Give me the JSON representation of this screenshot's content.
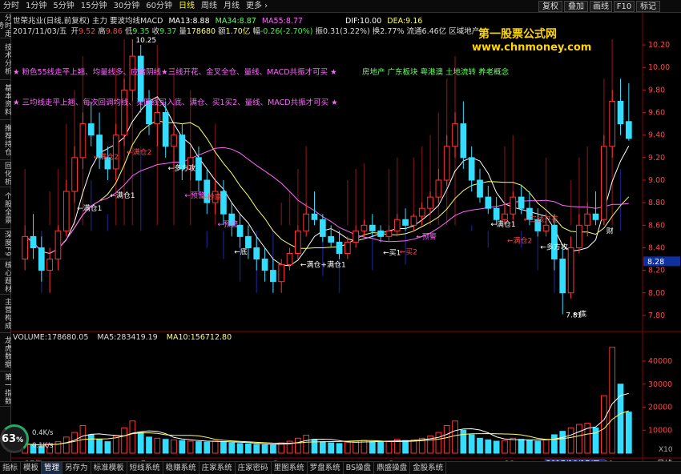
{
  "top_tabs": [
    {
      "label": "分时",
      "active": false
    },
    {
      "label": "1分钟",
      "active": false
    },
    {
      "label": "5分钟",
      "active": false
    },
    {
      "label": "15分钟",
      "active": false
    },
    {
      "label": "30分钟",
      "active": false
    },
    {
      "label": "60分钟",
      "active": false
    },
    {
      "label": "日线",
      "active": true
    },
    {
      "label": "周线",
      "active": false
    },
    {
      "label": "月线",
      "active": false
    },
    {
      "label": "更多 ›",
      "active": false
    }
  ],
  "right_buttons": [
    "复权",
    "叠加",
    "画线",
    "F10",
    "标记"
  ],
  "left_tabs": [
    "分时走势",
    "技术分析",
    "基本资料",
    "推荐持仓",
    "回化析",
    "个股全景",
    "深度F9",
    "核心题材",
    "主营构成",
    "龙虎数据",
    "第一指数"
  ],
  "info_line1": {
    "title": "世荣兆业(日线,前复权) 主力 要波均线MACD",
    "ma13_label": "MA13:",
    "ma13": "8.88",
    "ma34_label": "MA34:",
    "ma34": "8.87",
    "ma55_label": "MA55:",
    "ma55": "8.77",
    "dif_label": "DIF:",
    "dif": "10.00",
    "dea_label": "DEA:",
    "dea": "9.16"
  },
  "info_line2": {
    "date": "2017/11/03/五",
    "open_label": "开",
    "open": "9.52",
    "high_label": "高",
    "high": "9.86",
    "low_label": "低",
    "low": "9.35",
    "close_label": "收",
    "close": "9.37",
    "vol_label": "量",
    "vol": "178680",
    "amount_label": "额",
    "amount": "1.70亿",
    "change_label": "幅",
    "change": "-0.26(-2.70%)",
    "amp_label": "振",
    "amp": "0.31(3.22%)",
    "turnover_label": "换",
    "turnover": "2.77%",
    "float_label": "流通",
    "float": "6.46亿",
    "sector": "区域地产"
  },
  "watermark": {
    "line1": "第一股票公式网",
    "line2": "www.chnmoney.com"
  },
  "legends": {
    "line1": "★ 粉色55线走平上翘、均量线多、应倍阴线★三线开花、金叉全仓、量线、MACD共振才可买 ★",
    "line2": "★ 三均线走平上翘、每次回调均线、买阴线买入底、满仓、买1买2、量线、MACD共振才可买 ★",
    "sectors": "房地产    广东板块    粤港澳 土地流转 养老概念"
  },
  "chart_annotations": {
    "price_high": "10.25",
    "price_low": "7.81",
    "current_price": "8.28",
    "labels": [
      {
        "text": "←满仓1",
        "color": "#ffffff"
      },
      {
        "text": "←满仓2",
        "color": "#ff4444"
      },
      {
        "text": "←满仓1",
        "color": "#ffffff"
      },
      {
        "text": "←满仓2",
        "color": "#ff4444"
      },
      {
        "text": "←多方攻",
        "color": "#ffffff"
      },
      {
        "text": "←预警",
        "color": "#ff66ff"
      },
      {
        "text": "←抄底",
        "color": "#ff4444"
      },
      {
        "text": "←预警",
        "color": "#ff66ff"
      },
      {
        "text": "←底",
        "color": "#ffffff"
      },
      {
        "text": "←满仓+满仓1",
        "color": "#ffffff"
      },
      {
        "text": "←买1",
        "color": "#ffffff"
      },
      {
        "text": "←买2",
        "color": "#ff4444"
      },
      {
        "text": "←预警",
        "color": "#ff66ff"
      },
      {
        "text": "←满仓1",
        "color": "#ffffff"
      },
      {
        "text": "←满仓2",
        "color": "#ff4444"
      },
      {
        "text": "←三线开花",
        "color": "#ff4444"
      },
      {
        "text": "←多方攻",
        "color": "#ffffff"
      },
      {
        "text": "←底",
        "color": "#ffffff"
      },
      {
        "text": "财",
        "color": "#ffffff"
      }
    ]
  },
  "price_axis": [
    "10.20",
    "10.00",
    "9.80",
    "9.60",
    "9.40",
    "9.20",
    "9.00",
    "8.80",
    "8.60",
    "8.40",
    "8.20",
    "8.00",
    "7.80"
  ],
  "vol_axis": [
    "40000",
    "30000",
    "20000",
    "10000",
    "X10"
  ],
  "vol_info": {
    "vol_label": "VOLUME:",
    "vol": "178680.05",
    "ma5_label": "MA5:",
    "ma5": "283419.19",
    "ma10_label": "MA10:",
    "ma10": "156712.80"
  },
  "date_axis": [
    "17年",
    "7",
    "8",
    "9",
    "10",
    "2017/10/17/二",
    "11",
    "日线"
  ],
  "bottom_tabs": [
    "指标",
    "模板",
    "管理",
    "另存为",
    "标准模板",
    "短线系统",
    "稳赚系统",
    "庄家系统",
    "庄家密码",
    "里图系统",
    "罗盘系统",
    "BS操盘",
    "鼎盛操盘",
    "金股系统"
  ],
  "gauge": {
    "pct": "63",
    "pct_unit": "%",
    "up_rate": "0.4K/s",
    "down_rate": "0.1K/s"
  },
  "colors": {
    "up": "#ff3333",
    "down": "#33ddff",
    "ma13": "#ffffff",
    "ma34": "#ffff66",
    "ma55": "#ff66ff",
    "bg": "#000000"
  },
  "chart_data": {
    "type": "candlestick",
    "price_ylim": [
      7.7,
      10.3
    ],
    "vol_ylim": [
      0,
      48000
    ],
    "candles": [
      [
        8.3,
        8.6,
        8.2,
        8.5
      ],
      [
        8.5,
        8.7,
        8.3,
        8.4
      ],
      [
        8.4,
        8.5,
        8.1,
        8.2
      ],
      [
        8.2,
        8.4,
        8.0,
        8.3
      ],
      [
        8.3,
        8.6,
        8.2,
        8.55
      ],
      [
        8.55,
        9.0,
        8.5,
        8.9
      ],
      [
        8.9,
        9.3,
        8.8,
        9.2
      ],
      [
        9.2,
        9.6,
        9.1,
        9.5
      ],
      [
        9.5,
        9.7,
        9.3,
        9.4
      ],
      [
        9.4,
        9.6,
        9.1,
        9.2
      ],
      [
        9.2,
        9.3,
        9.0,
        9.1
      ],
      [
        9.1,
        9.5,
        9.0,
        9.4
      ],
      [
        9.4,
        9.9,
        9.3,
        9.8
      ],
      [
        9.8,
        10.25,
        9.7,
        10.1
      ],
      [
        10.1,
        10.2,
        9.6,
        9.7
      ],
      [
        9.7,
        9.8,
        9.4,
        9.5
      ],
      [
        9.5,
        9.7,
        9.3,
        9.6
      ],
      [
        9.6,
        9.7,
        9.2,
        9.3
      ],
      [
        9.3,
        9.5,
        9.1,
        9.4
      ],
      [
        9.4,
        9.5,
        9.0,
        9.1
      ],
      [
        9.1,
        9.3,
        9.0,
        9.2
      ],
      [
        9.2,
        9.3,
        8.9,
        9.0
      ],
      [
        9.0,
        9.1,
        8.7,
        8.8
      ],
      [
        8.8,
        9.0,
        8.7,
        8.9
      ],
      [
        8.9,
        9.0,
        8.6,
        8.7
      ],
      [
        8.7,
        8.8,
        8.5,
        8.6
      ],
      [
        8.6,
        8.7,
        8.4,
        8.5
      ],
      [
        8.5,
        8.6,
        8.3,
        8.4
      ],
      [
        8.4,
        8.5,
        8.2,
        8.3
      ],
      [
        8.3,
        8.4,
        8.1,
        8.2
      ],
      [
        8.2,
        8.3,
        8.0,
        8.1
      ],
      [
        8.1,
        8.3,
        8.0,
        8.25
      ],
      [
        8.25,
        8.4,
        8.2,
        8.35
      ],
      [
        8.35,
        8.6,
        8.3,
        8.55
      ],
      [
        8.55,
        8.8,
        8.5,
        8.7
      ],
      [
        8.7,
        8.9,
        8.6,
        8.65
      ],
      [
        8.65,
        8.7,
        8.45,
        8.5
      ],
      [
        8.5,
        8.6,
        8.4,
        8.45
      ],
      [
        8.45,
        8.55,
        8.3,
        8.35
      ],
      [
        8.35,
        8.5,
        8.3,
        8.45
      ],
      [
        8.45,
        8.6,
        8.4,
        8.55
      ],
      [
        8.55,
        8.65,
        8.5,
        8.6
      ],
      [
        8.6,
        8.7,
        8.5,
        8.55
      ],
      [
        8.55,
        8.6,
        8.45,
        8.5
      ],
      [
        8.5,
        8.6,
        8.45,
        8.55
      ],
      [
        8.55,
        8.7,
        8.5,
        8.65
      ],
      [
        8.65,
        8.75,
        8.55,
        8.6
      ],
      [
        8.6,
        8.7,
        8.55,
        8.68
      ],
      [
        8.68,
        8.8,
        8.6,
        8.75
      ],
      [
        8.75,
        8.9,
        8.7,
        8.85
      ],
      [
        8.85,
        9.1,
        8.8,
        9.0
      ],
      [
        9.0,
        9.4,
        8.95,
        9.3
      ],
      [
        9.3,
        9.6,
        9.2,
        9.5
      ],
      [
        9.5,
        9.7,
        9.1,
        9.2
      ],
      [
        9.2,
        9.3,
        8.9,
        9.0
      ],
      [
        9.0,
        9.1,
        8.8,
        8.85
      ],
      [
        8.85,
        8.95,
        8.7,
        8.75
      ],
      [
        8.75,
        8.85,
        8.6,
        8.65
      ],
      [
        8.65,
        8.8,
        8.6,
        8.7
      ],
      [
        8.7,
        8.9,
        8.65,
        8.85
      ],
      [
        8.85,
        8.95,
        8.7,
        8.75
      ],
      [
        8.75,
        8.9,
        8.6,
        8.65
      ],
      [
        8.65,
        8.75,
        8.5,
        8.55
      ],
      [
        8.55,
        8.7,
        8.5,
        8.6
      ],
      [
        8.6,
        8.7,
        8.2,
        8.3
      ],
      [
        8.3,
        8.4,
        7.81,
        8.0
      ],
      [
        8.0,
        8.5,
        7.95,
        8.4
      ],
      [
        8.4,
        8.7,
        8.35,
        8.6
      ],
      [
        8.6,
        8.8,
        8.5,
        8.7
      ],
      [
        8.7,
        8.9,
        8.6,
        8.65
      ],
      [
        8.65,
        9.4,
        8.6,
        9.3
      ],
      [
        9.3,
        9.8,
        9.2,
        9.7
      ],
      [
        9.7,
        9.9,
        9.4,
        9.5
      ],
      [
        9.52,
        9.86,
        9.35,
        9.37
      ]
    ],
    "volumes": [
      4000,
      3500,
      3000,
      4200,
      5000,
      7000,
      9000,
      12000,
      8000,
      6000,
      5000,
      7500,
      11000,
      14000,
      9000,
      7000,
      6500,
      6000,
      5800,
      5500,
      5200,
      5000,
      4800,
      5300,
      5000,
      4500,
      4200,
      4000,
      3800,
      3600,
      3500,
      4500,
      5200,
      6500,
      7800,
      6000,
      5000,
      4500,
      4200,
      4800,
      5200,
      5600,
      5000,
      4800,
      5300,
      6000,
      5500,
      5800,
      6500,
      7500,
      9000,
      12000,
      14000,
      10000,
      8000,
      6500,
      5800,
      5200,
      5500,
      6500,
      6000,
      5600,
      5200,
      5800,
      8000,
      9500,
      11000,
      12500,
      13000,
      11000,
      25000,
      46000,
      30000,
      17868
    ]
  }
}
